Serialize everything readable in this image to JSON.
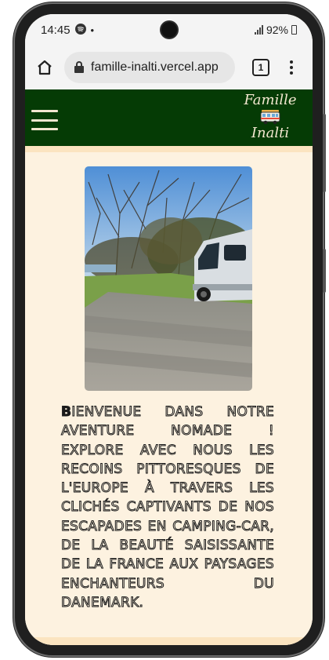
{
  "status_bar": {
    "time": "14:45",
    "battery": "92%",
    "icons": [
      "spotify-icon",
      "dot-icon",
      "camera-punch-hole",
      "signal-icon",
      "battery-icon"
    ]
  },
  "browser": {
    "url": "famille-inalti.vercel.app",
    "tab_count": "1",
    "icons": [
      "home-icon",
      "lock-icon",
      "tabs-icon",
      "more-vert-icon"
    ]
  },
  "site": {
    "brand_line1": "Famille",
    "brand_line2": "Inalti",
    "header_bg": "#053b05",
    "header_text_color": "#f3e7cf",
    "page_bg": "#fdf2e0",
    "accent_border": "#fbe4c0"
  },
  "content": {
    "photo_alt": "camper-van-by-river-photo",
    "intro_text": "Bienvenue dans notre aventure nomade ! Explore avec nous les recoins pittoresques de l'Europe à travers les clichés captivants de nos escapades en camping-car, de la beauté saisissante de la France aux paysages enchanteurs du Danemark."
  }
}
